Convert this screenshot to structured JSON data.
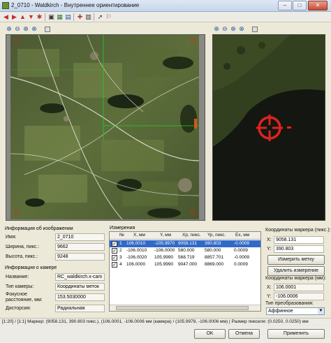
{
  "window": {
    "title": "2_0710 - Waldkirch - Внутреннее ориентирование",
    "minimize": "–",
    "maximize": "□",
    "close": "✕"
  },
  "toolbar": {
    "icons": [
      "arrow-left-icon",
      "arrow-right-icon",
      "arrow-up-icon",
      "arrow-down-icon",
      "reset-icon",
      "camera-icon",
      "grid-icon",
      "page-icon",
      "marker-icon",
      "tool-icon",
      "pointer-icon"
    ]
  },
  "zoom_toolbar": {
    "icons": [
      "zoom-in-icon",
      "zoom-out-icon",
      "zoom-fit-icon",
      "zoom-reset-icon",
      "frame-icon"
    ]
  },
  "image_info": {
    "title": "Информация об изображении",
    "name_label": "Имя:",
    "name_value": "2_0710",
    "width_label": "Ширина, пикс.:",
    "width_value": "9662",
    "height_label": "Высота, пикс.:",
    "height_value": "9248"
  },
  "camera_info": {
    "title": "Информация о камере",
    "name_label": "Название:",
    "name_value": "RC_waldkirch.x-cam",
    "type_label": "Тип камеры:",
    "type_value": "Координаты меток",
    "focal_label_1": "Фокусное",
    "focal_label_2": "расстояние, мм:",
    "focal_value": "153.5030000",
    "distortion_label": "Дисторсия:",
    "distortion_value": "Радиальная"
  },
  "measurements": {
    "title": "Измерения",
    "columns": [
      "№",
      "X, мм",
      "Y, мм",
      "Xp, пикс.",
      "Yp, пикс.",
      "Ex, мм"
    ],
    "rows": [
      {
        "n": "1",
        "x": "106.0010",
        "y": "-105.9970",
        "xp": "9058.131",
        "yp": "390.803",
        "ex": "-0.0009",
        "checked": true,
        "selected": true
      },
      {
        "n": "2",
        "x": "-106.0010",
        "y": "-106.0000",
        "xp": "580.000",
        "yp": "580.000",
        "ex": "0.0009",
        "checked": true,
        "selected": false
      },
      {
        "n": "3",
        "x": "-106.0020",
        "y": "105.9990",
        "xp": "568.719",
        "yp": "8857.701",
        "ex": "-0.0009",
        "checked": true,
        "selected": false
      },
      {
        "n": "4",
        "x": "106.0000",
        "y": "105.9990",
        "xp": "9047.000",
        "yp": "8869.000",
        "ex": "0.0009",
        "checked": true,
        "selected": false
      }
    ]
  },
  "marker_pixel": {
    "title": "Координаты маркера (пикс.):",
    "x_label": "X:",
    "x_value": "9058.131",
    "y_label": "Y:",
    "y_value": "390.803"
  },
  "buttons": {
    "measure": "Измерить метку",
    "delete": "Удалить измерение",
    "ok": "OK",
    "cancel": "Отмена",
    "apply": "Применить"
  },
  "marker_mm": {
    "title": "Координаты маркера (мм):",
    "x_label": "X:",
    "x_value": "106.0001",
    "y_label": "Y:",
    "y_value": "-106.0006"
  },
  "transform": {
    "label": "Тип преобразования:",
    "value": "Аффинное"
  },
  "status": {
    "text": "[1:20] / [1:1] Маркер: (9058.131, 390.803 пикс.), (106.0001, -106.0006 мм (камера) / (105.9978, -106.0006 мм) | Размер пикселя: (0.0250, 0.0250) мм"
  },
  "colors": {
    "marker_red": "#e0231b",
    "selection_blue": "#3169c6",
    "crosshair_green": "#1fd12a"
  }
}
